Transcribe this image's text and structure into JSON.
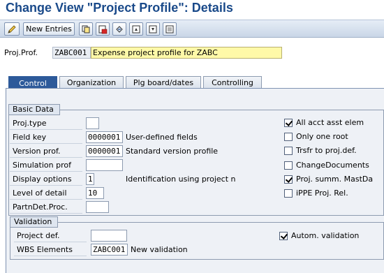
{
  "window": {
    "title": "Change View \"Project Profile\": Details"
  },
  "toolbar": {
    "new_entries_label": "New Entries",
    "icons": [
      "edit-icon",
      "copy-icon",
      "delete-icon",
      "undo-icon",
      "first-entry-icon",
      "next-entry-icon",
      "export-icon"
    ]
  },
  "header": {
    "proj_prof_label": "Proj.Prof.",
    "proj_prof_value": "ZABC001",
    "proj_prof_description": "Expense project profile for ZABC"
  },
  "tabs": [
    {
      "label": "Control",
      "active": true
    },
    {
      "label": "Organization",
      "active": false
    },
    {
      "label": "Plg board/dates",
      "active": false
    },
    {
      "label": "Controlling",
      "active": false
    }
  ],
  "basic_data": {
    "title": "Basic Data",
    "fields": [
      {
        "label": "Proj.type",
        "value": "",
        "description": ""
      },
      {
        "label": "Field key",
        "value": "0000001",
        "description": "User-defined fields"
      },
      {
        "label": "Version prof.",
        "value": "0000001",
        "description": "Standard version profile"
      },
      {
        "label": "Simulation prof",
        "value": "",
        "description": ""
      },
      {
        "label": "Display options",
        "value": "1",
        "description": "Identification using project n"
      },
      {
        "label": "Level of detail",
        "value": "10",
        "description": ""
      },
      {
        "label": "PartnDet.Proc.",
        "value": "",
        "description": ""
      }
    ],
    "checkboxes": [
      {
        "label": "All acct asst elem",
        "checked": true
      },
      {
        "label": "Only one root",
        "checked": false
      },
      {
        "label": "Trsfr to proj.def.",
        "checked": false
      },
      {
        "label": "ChangeDocuments",
        "checked": false
      },
      {
        "label": "Proj. summ. MastDa",
        "checked": true
      },
      {
        "label": "iPPE Proj. Rel.",
        "checked": false
      }
    ]
  },
  "validation": {
    "title": "Validation",
    "project_def_label": "Project def.",
    "project_def_value": "",
    "wbs_label": "WBS Elements",
    "wbs_value": "ZABC001",
    "wbs_description": "New validation",
    "autom_label": "Autom. validation",
    "autom_checked": true
  },
  "colors": {
    "title": "#1a4a8a",
    "active_tab": "#2d5a9a",
    "highlight_field": "#fff9a8",
    "panel_bg": "#eef1f6"
  }
}
